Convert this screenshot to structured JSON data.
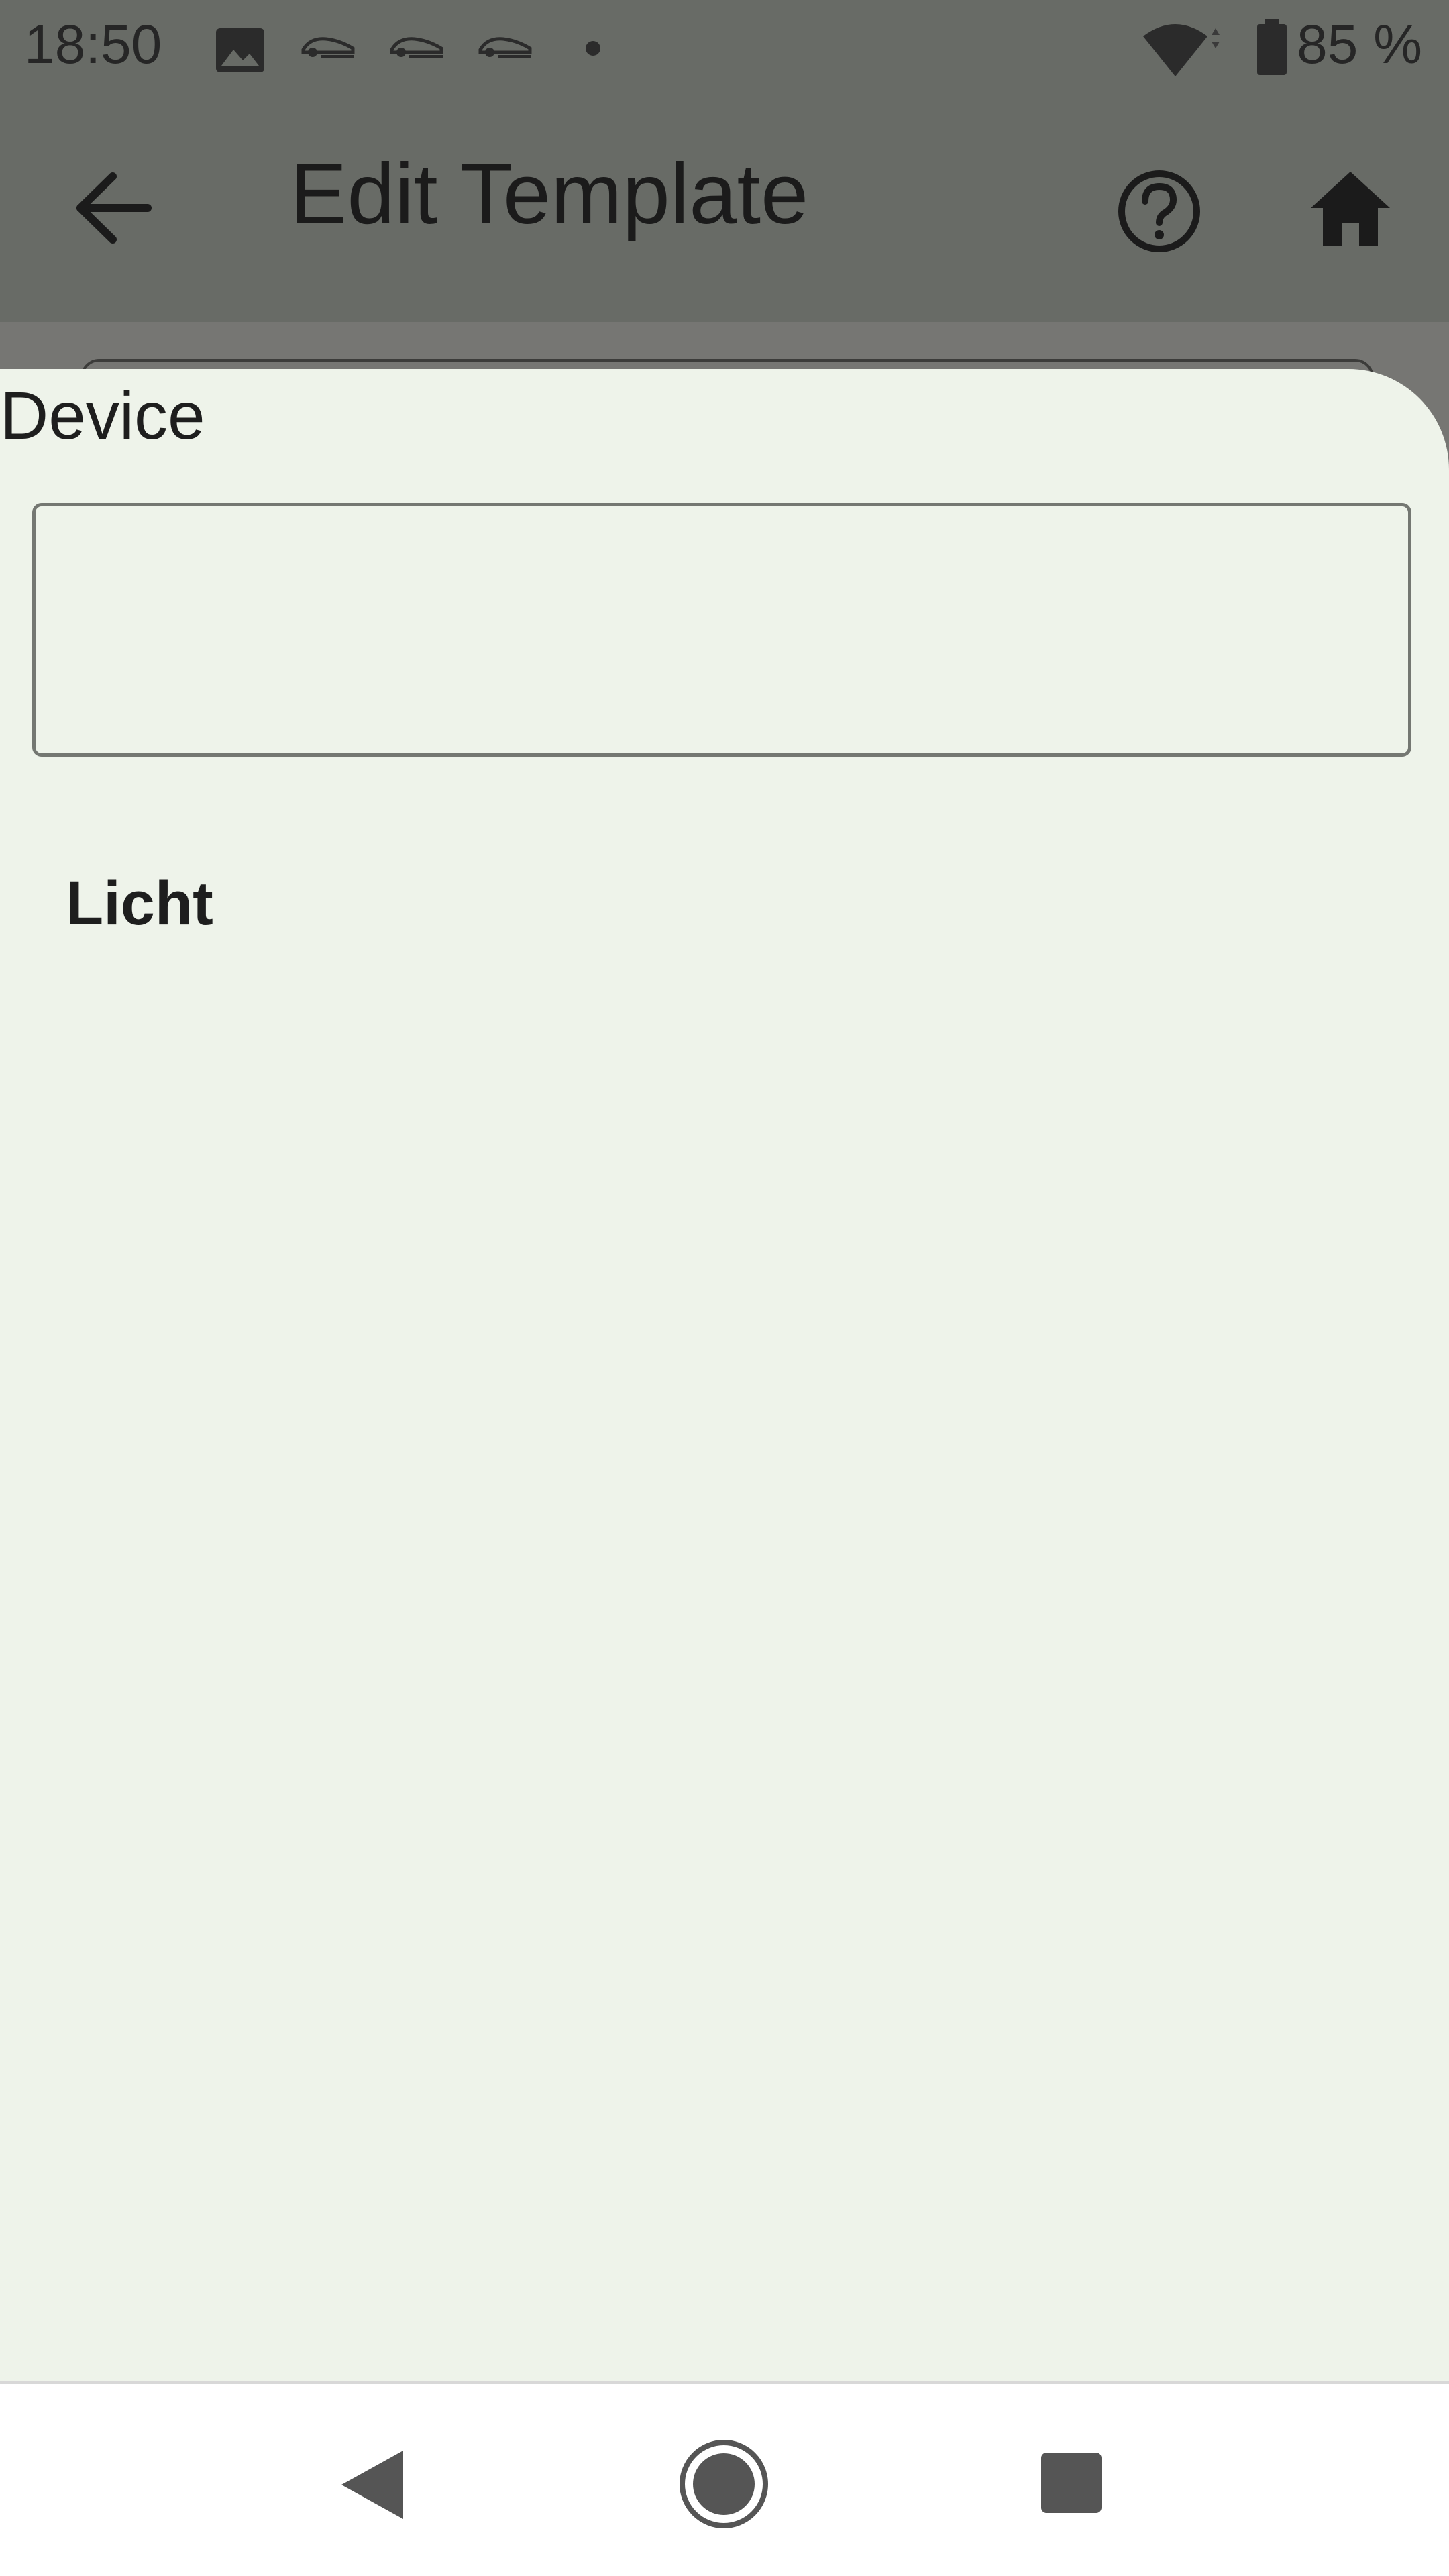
{
  "status_bar": {
    "time": "18:50",
    "battery": "85 %",
    "icons": [
      "image-icon",
      "car-icon",
      "car-icon",
      "car-icon",
      "dot-icon",
      "wifi-icon",
      "battery-icon"
    ]
  },
  "app_bar": {
    "title": "Edit Template",
    "back_icon": "arrow-back-icon",
    "help_icon": "help-icon",
    "home_icon": "home-icon"
  },
  "sheet": {
    "title": "Device",
    "input_value": "",
    "items": [
      {
        "label": "Licht"
      }
    ]
  },
  "nav_bar": {
    "icons": [
      "nav-back-icon",
      "nav-home-icon",
      "nav-recents-icon"
    ]
  },
  "colors": {
    "scrim": "#686b66",
    "sheet_bg": "#eef3ea",
    "text": "#1e1e1e",
    "outline": "#747772"
  }
}
